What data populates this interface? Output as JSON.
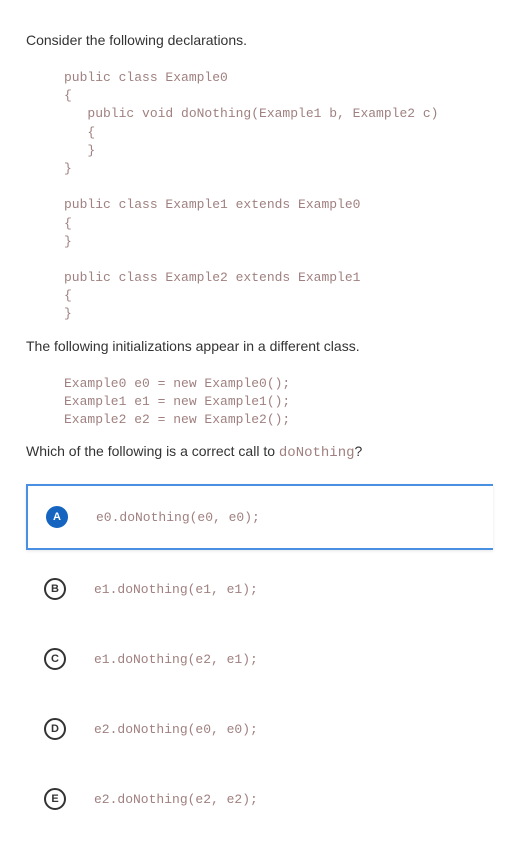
{
  "question": {
    "intro": "Consider the following declarations.",
    "code1": "public class Example0\n{\n   public void doNothing(Example1 b, Example2 c)\n   {\n   }\n}\n\npublic class Example1 extends Example0\n{\n}\n\npublic class Example2 extends Example1\n{\n}",
    "mid": "The following initializations appear in a different class.",
    "code2": "Example0 e0 = new Example0();\nExample1 e1 = new Example1();\nExample2 e2 = new Example2();",
    "prompt_prefix": "Which of the following is a correct call to ",
    "prompt_code": "doNothing",
    "prompt_suffix": "?"
  },
  "options": [
    {
      "letter": "A",
      "code": "e0.doNothing(e0, e0);",
      "selected": true
    },
    {
      "letter": "B",
      "code": "e1.doNothing(e1, e1);",
      "selected": false
    },
    {
      "letter": "C",
      "code": "e1.doNothing(e2, e1);",
      "selected": false
    },
    {
      "letter": "D",
      "code": "e2.doNothing(e0, e0);",
      "selected": false
    },
    {
      "letter": "E",
      "code": "e2.doNothing(e2, e2);",
      "selected": false
    }
  ]
}
